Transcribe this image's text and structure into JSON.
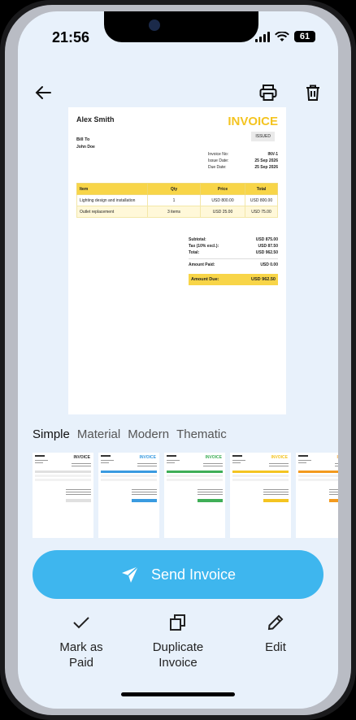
{
  "status": {
    "time": "21:56",
    "battery": "61"
  },
  "invoice": {
    "from_name": "Alex Smith",
    "title": "INVOICE",
    "status_badge": "ISSUED",
    "bill_to_label": "Bill To",
    "client_name": "John Doe",
    "meta": [
      {
        "label": "Invoice No:",
        "value": "INV-1"
      },
      {
        "label": "Issue Date:",
        "value": "25 Sep 2026"
      },
      {
        "label": "Due Date:",
        "value": "25 Sep 2026"
      }
    ],
    "table_headers": [
      "Item",
      "Qty",
      "Price",
      "Total"
    ],
    "items": [
      {
        "item": "Lighting design and installation",
        "qty": "1",
        "price": "USD 800.00",
        "total": "USD 800.00"
      },
      {
        "item": "Outlet replacement",
        "qty": "3 items",
        "price": "USD 25.00",
        "total": "USD 75.00"
      }
    ],
    "totals": [
      {
        "label": "Subtotal:",
        "value": "USD 875.00"
      },
      {
        "label": "Tax (10% excl.):",
        "value": "USD 87.50"
      },
      {
        "label": "Total:",
        "value": "USD 962.50"
      }
    ],
    "amount_paid": {
      "label": "Amount Paid:",
      "value": "USD 0.00"
    },
    "amount_due": {
      "label": "Amount Due:",
      "value": "USD 962.50"
    }
  },
  "template_tabs": [
    "Simple",
    "Material",
    "Modern",
    "Thematic"
  ],
  "thumbnails": [
    {
      "accent": "#e0e0e0",
      "title_color": "#333333"
    },
    {
      "accent": "#3a9be0",
      "title_color": "#3a9be0"
    },
    {
      "accent": "#3fae57",
      "title_color": "#3fae57"
    },
    {
      "accent": "#f4c421",
      "title_color": "#f4c421"
    },
    {
      "accent": "#f39a1e",
      "title_color": "#f39a1e"
    }
  ],
  "send_button": {
    "label": "Send Invoice",
    "icon": "send-icon"
  },
  "actions": {
    "mark_paid": {
      "line1": "Mark as",
      "line2": "Paid",
      "icon": "check-icon"
    },
    "duplicate": {
      "line1": "Duplicate",
      "line2": "Invoice",
      "icon": "copy-icon"
    },
    "edit": {
      "line1": "Edit",
      "icon": "pencil-icon"
    }
  },
  "colors": {
    "accent": "#3eb6ee",
    "invoice_yellow": "#f4c421",
    "background": "#e8f1fb"
  }
}
